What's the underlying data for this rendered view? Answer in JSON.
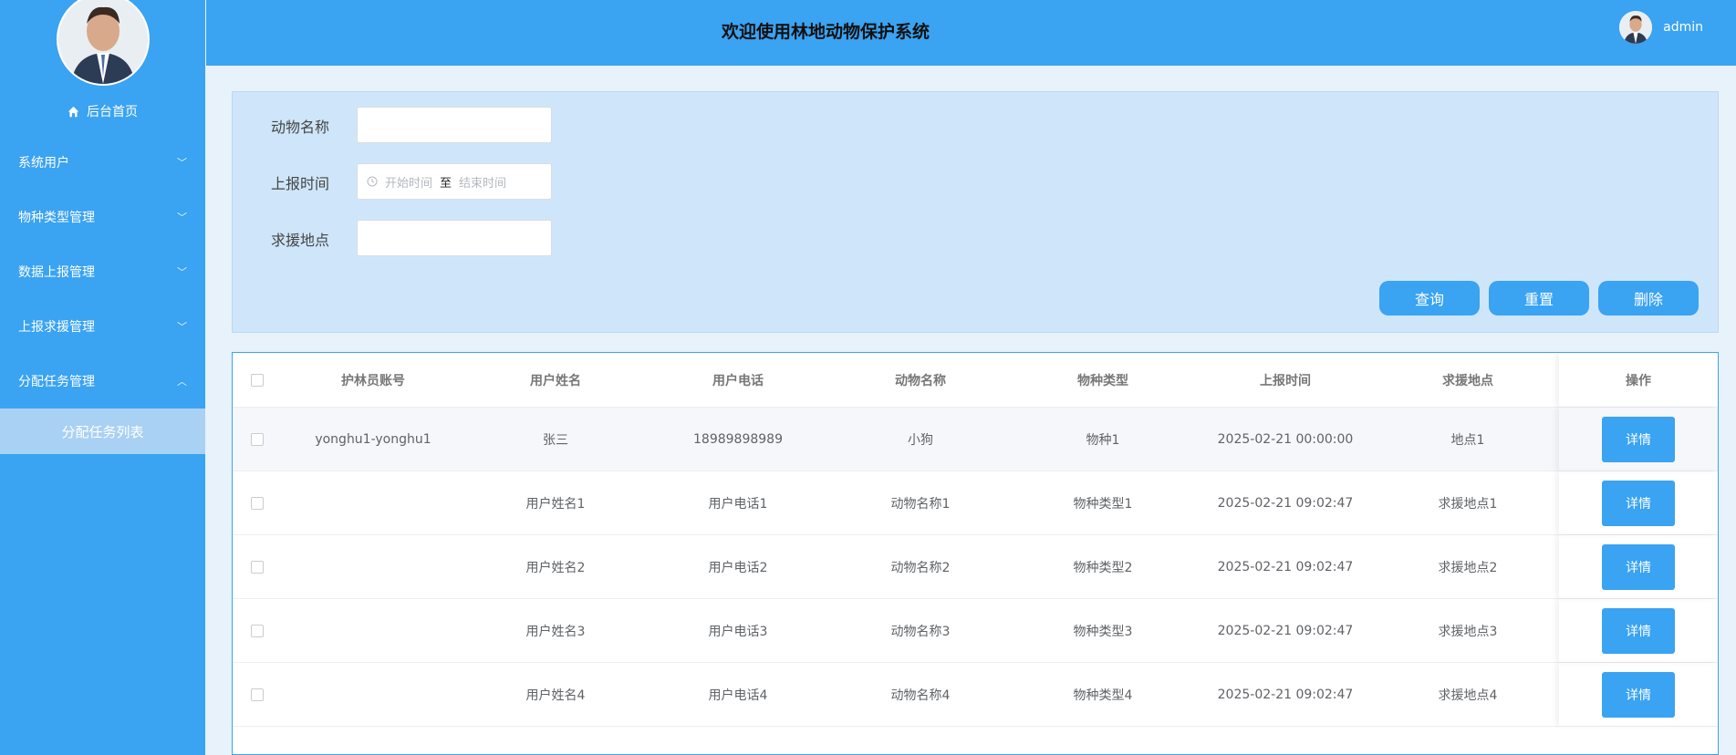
{
  "sidebar": {
    "home_label": "后台首页",
    "menus": [
      {
        "label": "系统用户",
        "expanded": false
      },
      {
        "label": "物种类型管理",
        "expanded": false
      },
      {
        "label": "数据上报管理",
        "expanded": false
      },
      {
        "label": "上报求援管理",
        "expanded": false
      },
      {
        "label": "分配任务管理",
        "expanded": true
      }
    ],
    "submenu_active": "分配任务列表"
  },
  "header": {
    "title": "欢迎使用林地动物保护系统",
    "username": "admin"
  },
  "search": {
    "animal_name_label": "动物名称",
    "animal_name_value": "",
    "report_time_label": "上报时间",
    "start_placeholder": "开始时间",
    "range_sep": "至",
    "end_placeholder": "结束时间",
    "rescue_location_label": "求援地点",
    "rescue_location_value": "",
    "query_button": "查询",
    "reset_button": "重置",
    "delete_button": "删除"
  },
  "table": {
    "columns": [
      "护林员账号",
      "用户姓名",
      "用户电话",
      "动物名称",
      "物种类型",
      "上报时间",
      "求援地点",
      "操作"
    ],
    "detail_label": "详情",
    "rows": [
      [
        "yonghu1-yonghu1",
        "张三",
        "18989898989",
        "小狗",
        "物种1",
        "2025-02-21 00:00:00",
        "地点1"
      ],
      [
        "",
        "用户姓名1",
        "用户电话1",
        "动物名称1",
        "物种类型1",
        "2025-02-21 09:02:47",
        "求援地点1"
      ],
      [
        "",
        "用户姓名2",
        "用户电话2",
        "动物名称2",
        "物种类型2",
        "2025-02-21 09:02:47",
        "求援地点2"
      ],
      [
        "",
        "用户姓名3",
        "用户电话3",
        "动物名称3",
        "物种类型3",
        "2025-02-21 09:02:47",
        "求援地点3"
      ],
      [
        "",
        "用户姓名4",
        "用户电话4",
        "动物名称4",
        "物种类型4",
        "2025-02-21 09:02:47",
        "求援地点4"
      ]
    ]
  },
  "colors": {
    "primary": "#3aa3f2",
    "submenu_bg": "#a9d1f3",
    "panel_bg": "#cfe6fa"
  }
}
